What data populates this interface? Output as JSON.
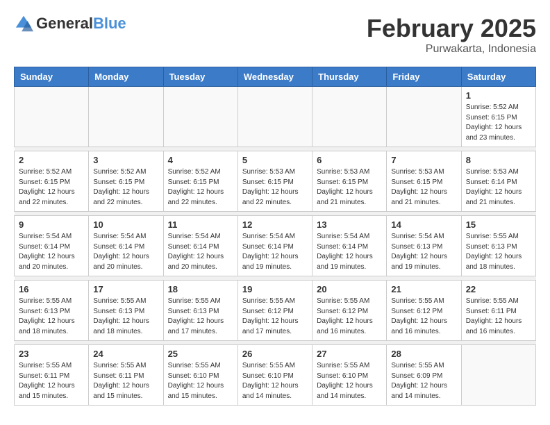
{
  "header": {
    "logo_general": "General",
    "logo_blue": "Blue",
    "title": "February 2025",
    "subtitle": "Purwakarta, Indonesia"
  },
  "weekdays": [
    "Sunday",
    "Monday",
    "Tuesday",
    "Wednesday",
    "Thursday",
    "Friday",
    "Saturday"
  ],
  "weeks": [
    {
      "days": [
        {
          "num": "",
          "info": ""
        },
        {
          "num": "",
          "info": ""
        },
        {
          "num": "",
          "info": ""
        },
        {
          "num": "",
          "info": ""
        },
        {
          "num": "",
          "info": ""
        },
        {
          "num": "",
          "info": ""
        },
        {
          "num": "1",
          "info": "Sunrise: 5:52 AM\nSunset: 6:15 PM\nDaylight: 12 hours\nand 23 minutes."
        }
      ]
    },
    {
      "days": [
        {
          "num": "2",
          "info": "Sunrise: 5:52 AM\nSunset: 6:15 PM\nDaylight: 12 hours\nand 22 minutes."
        },
        {
          "num": "3",
          "info": "Sunrise: 5:52 AM\nSunset: 6:15 PM\nDaylight: 12 hours\nand 22 minutes."
        },
        {
          "num": "4",
          "info": "Sunrise: 5:52 AM\nSunset: 6:15 PM\nDaylight: 12 hours\nand 22 minutes."
        },
        {
          "num": "5",
          "info": "Sunrise: 5:53 AM\nSunset: 6:15 PM\nDaylight: 12 hours\nand 22 minutes."
        },
        {
          "num": "6",
          "info": "Sunrise: 5:53 AM\nSunset: 6:15 PM\nDaylight: 12 hours\nand 21 minutes."
        },
        {
          "num": "7",
          "info": "Sunrise: 5:53 AM\nSunset: 6:15 PM\nDaylight: 12 hours\nand 21 minutes."
        },
        {
          "num": "8",
          "info": "Sunrise: 5:53 AM\nSunset: 6:14 PM\nDaylight: 12 hours\nand 21 minutes."
        }
      ]
    },
    {
      "days": [
        {
          "num": "9",
          "info": "Sunrise: 5:54 AM\nSunset: 6:14 PM\nDaylight: 12 hours\nand 20 minutes."
        },
        {
          "num": "10",
          "info": "Sunrise: 5:54 AM\nSunset: 6:14 PM\nDaylight: 12 hours\nand 20 minutes."
        },
        {
          "num": "11",
          "info": "Sunrise: 5:54 AM\nSunset: 6:14 PM\nDaylight: 12 hours\nand 20 minutes."
        },
        {
          "num": "12",
          "info": "Sunrise: 5:54 AM\nSunset: 6:14 PM\nDaylight: 12 hours\nand 19 minutes."
        },
        {
          "num": "13",
          "info": "Sunrise: 5:54 AM\nSunset: 6:14 PM\nDaylight: 12 hours\nand 19 minutes."
        },
        {
          "num": "14",
          "info": "Sunrise: 5:54 AM\nSunset: 6:13 PM\nDaylight: 12 hours\nand 19 minutes."
        },
        {
          "num": "15",
          "info": "Sunrise: 5:55 AM\nSunset: 6:13 PM\nDaylight: 12 hours\nand 18 minutes."
        }
      ]
    },
    {
      "days": [
        {
          "num": "16",
          "info": "Sunrise: 5:55 AM\nSunset: 6:13 PM\nDaylight: 12 hours\nand 18 minutes."
        },
        {
          "num": "17",
          "info": "Sunrise: 5:55 AM\nSunset: 6:13 PM\nDaylight: 12 hours\nand 18 minutes."
        },
        {
          "num": "18",
          "info": "Sunrise: 5:55 AM\nSunset: 6:13 PM\nDaylight: 12 hours\nand 17 minutes."
        },
        {
          "num": "19",
          "info": "Sunrise: 5:55 AM\nSunset: 6:12 PM\nDaylight: 12 hours\nand 17 minutes."
        },
        {
          "num": "20",
          "info": "Sunrise: 5:55 AM\nSunset: 6:12 PM\nDaylight: 12 hours\nand 16 minutes."
        },
        {
          "num": "21",
          "info": "Sunrise: 5:55 AM\nSunset: 6:12 PM\nDaylight: 12 hours\nand 16 minutes."
        },
        {
          "num": "22",
          "info": "Sunrise: 5:55 AM\nSunset: 6:11 PM\nDaylight: 12 hours\nand 16 minutes."
        }
      ]
    },
    {
      "days": [
        {
          "num": "23",
          "info": "Sunrise: 5:55 AM\nSunset: 6:11 PM\nDaylight: 12 hours\nand 15 minutes."
        },
        {
          "num": "24",
          "info": "Sunrise: 5:55 AM\nSunset: 6:11 PM\nDaylight: 12 hours\nand 15 minutes."
        },
        {
          "num": "25",
          "info": "Sunrise: 5:55 AM\nSunset: 6:10 PM\nDaylight: 12 hours\nand 15 minutes."
        },
        {
          "num": "26",
          "info": "Sunrise: 5:55 AM\nSunset: 6:10 PM\nDaylight: 12 hours\nand 14 minutes."
        },
        {
          "num": "27",
          "info": "Sunrise: 5:55 AM\nSunset: 6:10 PM\nDaylight: 12 hours\nand 14 minutes."
        },
        {
          "num": "28",
          "info": "Sunrise: 5:55 AM\nSunset: 6:09 PM\nDaylight: 12 hours\nand 14 minutes."
        },
        {
          "num": "",
          "info": ""
        }
      ]
    }
  ]
}
